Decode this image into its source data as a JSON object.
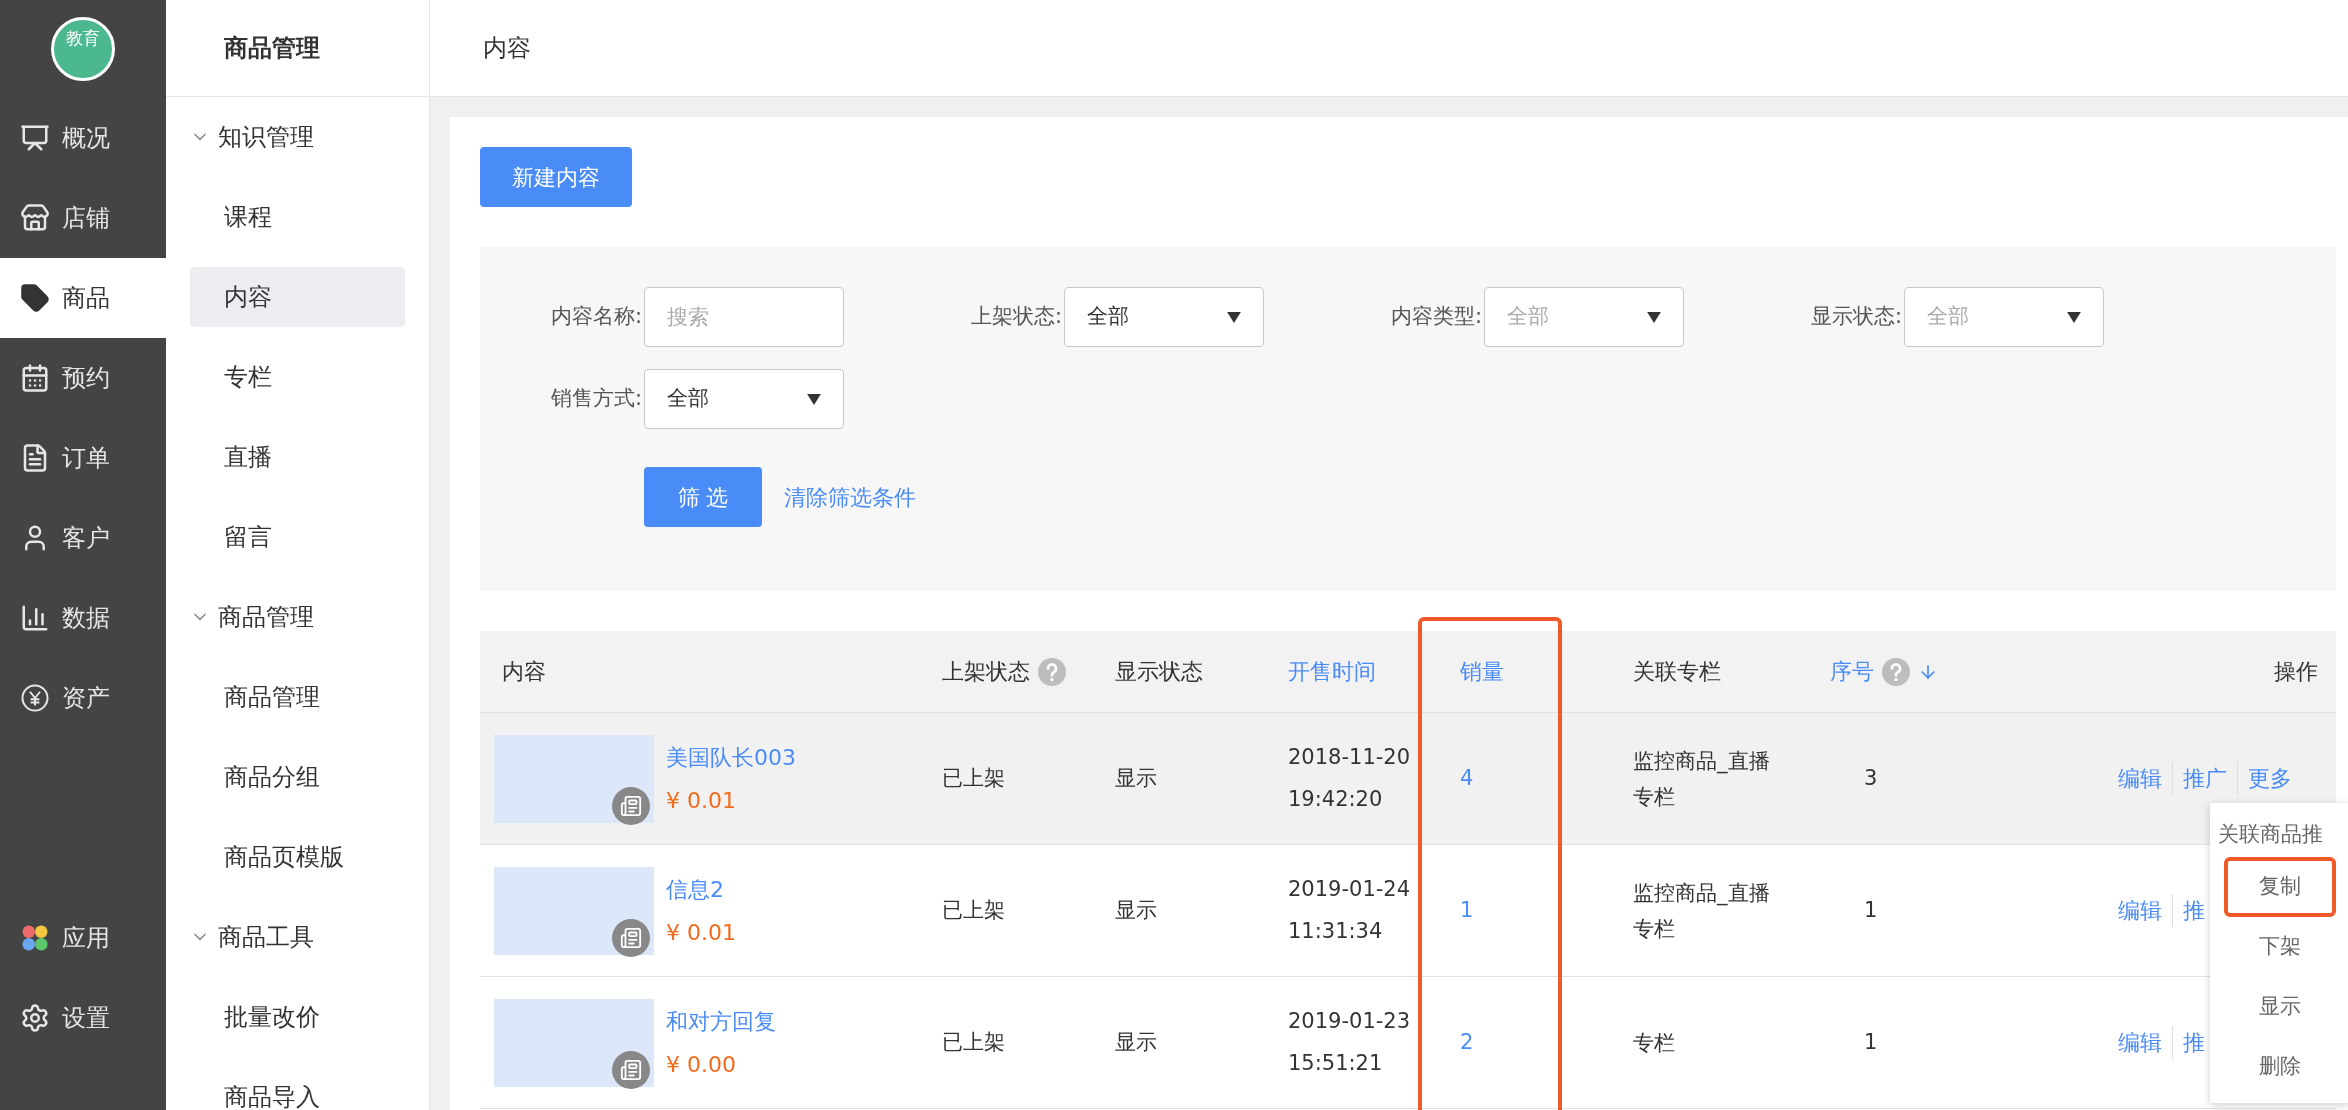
{
  "logo": {
    "text": "教育"
  },
  "nav": [
    {
      "label": "概况",
      "selected": false
    },
    {
      "label": "店铺",
      "selected": false
    },
    {
      "label": "商品",
      "selected": true
    },
    {
      "label": "预约",
      "selected": false
    },
    {
      "label": "订单",
      "selected": false
    },
    {
      "label": "客户",
      "selected": false
    },
    {
      "label": "数据",
      "selected": false
    },
    {
      "label": "资产",
      "selected": false
    }
  ],
  "nav_bottom": [
    {
      "label": "应用",
      "selected": false
    },
    {
      "label": "设置",
      "selected": false
    }
  ],
  "submenu": {
    "title": "商品管理",
    "groups": [
      {
        "label": "知识管理",
        "expanded": true,
        "children": [
          {
            "label": "课程",
            "selected": false
          },
          {
            "label": "内容",
            "selected": true
          },
          {
            "label": "专栏",
            "selected": false
          },
          {
            "label": "直播",
            "selected": false
          },
          {
            "label": "留言",
            "selected": false
          }
        ]
      },
      {
        "label": "商品管理",
        "expanded": true,
        "children": [
          {
            "label": "商品管理",
            "selected": false
          },
          {
            "label": "商品分组",
            "selected": false
          },
          {
            "label": "商品页模版",
            "selected": false
          }
        ]
      },
      {
        "label": "商品工具",
        "expanded": true,
        "children": [
          {
            "label": "批量改价",
            "selected": false
          },
          {
            "label": "商品导入",
            "selected": false
          }
        ]
      }
    ]
  },
  "page": {
    "title": "内容"
  },
  "new_button": "新建内容",
  "filters": [
    {
      "label": "内容名称:",
      "kind": "input",
      "placeholder": "搜索"
    },
    {
      "label": "上架状态:",
      "kind": "select",
      "value": "全部"
    },
    {
      "label": "内容类型:",
      "kind": "select",
      "placeholder": "全部"
    },
    {
      "label": "显示状态:",
      "kind": "select",
      "placeholder": "全部"
    },
    {
      "label": "销售方式:",
      "kind": "select",
      "value": "全部"
    }
  ],
  "filter_button": "筛 选",
  "clear_link": "清除筛选条件",
  "table": {
    "columns": [
      {
        "label": "内容",
        "link": false
      },
      {
        "label": "上架状态",
        "link": false,
        "help": true
      },
      {
        "label": "显示状态",
        "link": false
      },
      {
        "label": "开售时间",
        "link": true
      },
      {
        "label": "销量",
        "link": true,
        "highlighted": true
      },
      {
        "label": "关联专栏",
        "link": false
      },
      {
        "label": "序号",
        "link": true,
        "help": true,
        "sorted_descending": true
      },
      {
        "label": "操作",
        "link": false
      }
    ],
    "rows": [
      {
        "title": "美国队长003",
        "price": "¥ 0.01",
        "status": "已上架",
        "display": "显示",
        "date": "2018-11-20",
        "clock": "19:42:20",
        "sales": "4",
        "column": "监控商品_直播专栏",
        "seq": "3",
        "actions": [
          "编辑",
          "推广",
          "更多"
        ],
        "hovered": true
      },
      {
        "title": "信息2",
        "price": "¥ 0.01",
        "status": "已上架",
        "display": "显示",
        "date": "2019-01-24",
        "clock": "11:31:34",
        "sales": "1",
        "column": "监控商品_直播专栏",
        "seq": "1",
        "actions": [
          "编辑",
          "推"
        ],
        "hovered": false
      },
      {
        "title": "和对方回复",
        "price": "¥ 0.00",
        "status": "已上架",
        "display": "显示",
        "date": "2019-01-23",
        "clock": "15:51:21",
        "sales": "2",
        "column": "专栏",
        "seq": "1",
        "actions": [
          "编辑",
          "推"
        ],
        "hovered": false
      }
    ]
  },
  "dropdown": {
    "items": [
      {
        "label": "关联商品推",
        "highlighted": false
      },
      {
        "label": "复制",
        "highlighted": true
      },
      {
        "label": "下架",
        "highlighted": false
      },
      {
        "label": "显示",
        "highlighted": false
      },
      {
        "label": "删除",
        "highlighted": false
      }
    ]
  }
}
